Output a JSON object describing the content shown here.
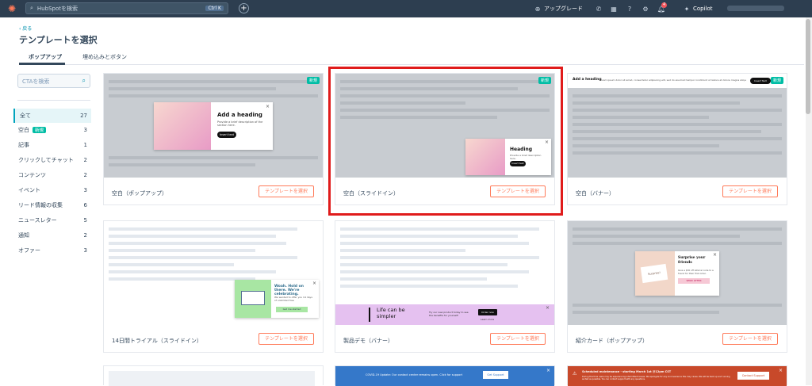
{
  "topbar": {
    "search_placeholder": "HubSpotを検索",
    "shortcut": "Ctrl K",
    "upgrade": "アップグレード",
    "notif_count": "4",
    "copilot": "Copilot"
  },
  "header": {
    "back": "‹ 戻る",
    "title": "テンプレートを選択"
  },
  "tabs": [
    "ポップアップ",
    "埋め込みとボタン"
  ],
  "sidebar": {
    "search_placeholder": "CTAを検索",
    "categories": [
      {
        "label": "全て",
        "count": "27"
      },
      {
        "label": "空白",
        "count": "3",
        "tag": "新規"
      },
      {
        "label": "記事",
        "count": "1"
      },
      {
        "label": "クリックしてチャット",
        "count": "2"
      },
      {
        "label": "コンテンツ",
        "count": "2"
      },
      {
        "label": "イベント",
        "count": "3"
      },
      {
        "label": "リード情報の収集",
        "count": "6"
      },
      {
        "label": "ニュースレター",
        "count": "5"
      },
      {
        "label": "通知",
        "count": "2"
      },
      {
        "label": "オファー",
        "count": "3"
      }
    ]
  },
  "cards": {
    "button_label": "テンプレートを選択",
    "new_tag": "新規",
    "c1": {
      "name": "空白（ポップアップ）",
      "heading": "Add a heading",
      "desc": "Provide a brief description of the section here.",
      "btn": "Insert text"
    },
    "c2": {
      "name": "空白（スライドイン）",
      "heading": "Heading",
      "desc": "Provide a brief description here.",
      "btn": "Insert text"
    },
    "c3": {
      "name": "空白（バナー）",
      "heading": "Add a heading",
      "desc": "Lorem ipsum dolor sit amet, consectetur adipiscing elit, sed do eiusmod tempor incididunt ut labore et dolore magna aliqua.",
      "btn": "Insert Text"
    },
    "c4": {
      "name": "14日間トライアル（スライドイン）",
      "heading": "Woah. Hold on there. We're celebrating.",
      "desc": "We wanted to offer you 14 days of unlimited free",
      "btn": "Get me started"
    },
    "c5": {
      "name": "製品デモ（バナー）",
      "heading": "Life can be simpler",
      "desc": "Try our new product today to see the benefits for yourself!",
      "btn": "Order now",
      "sub": "Learn more"
    },
    "c6": {
      "name": "紹介カード（ポップアップ）",
      "heading": "Surprise your friends",
      "desc": "Give a $30 off referral code to a friend for their first order.",
      "btn": "SEND OFFER",
      "card": "Surprise!"
    },
    "c7": {
      "text": "COVID-19 Update: Our contact center remains open. Click for support",
      "btn": "Get Support"
    },
    "c8": {
      "text": "Scheduled maintenance - starting March 1st @12pm CST",
      "desc": "During this time users may be experiencing intermittent issues. We apologize for any inconvenience this may cause. We will be back up and running as fast as possible. You can contact support with any questions.",
      "btn": "Contact Support"
    }
  }
}
